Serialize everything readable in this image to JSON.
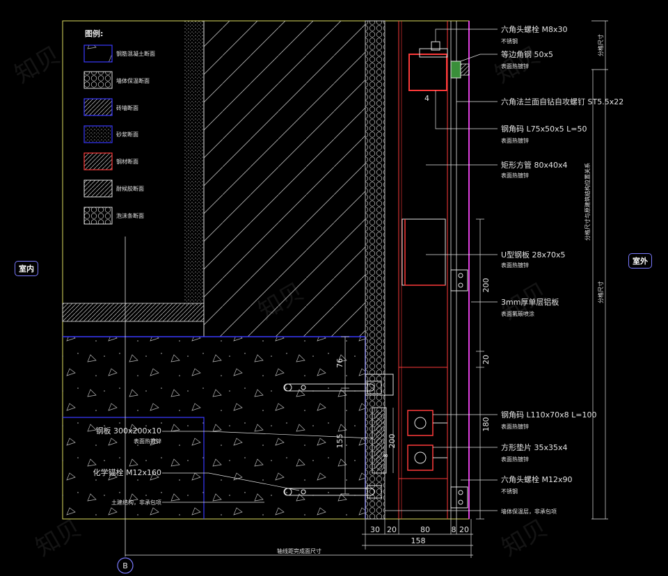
{
  "tags": {
    "indoor": "室内",
    "outdoor": "室外",
    "axis": "B"
  },
  "legend": {
    "title": "图例:",
    "items": [
      {
        "label": "钢筋混凝土断面"
      },
      {
        "label": "墙体保温断面"
      },
      {
        "label": "砖墙断面"
      },
      {
        "label": "砂浆断面"
      },
      {
        "label": "钢材断面"
      },
      {
        "label": "耐候胶断面"
      },
      {
        "label": "泡沫条断面"
      }
    ]
  },
  "callouts_right": [
    {
      "main": "六角头螺栓 M8x30",
      "sub": "不锈钢"
    },
    {
      "main": "等边角钢 50x5",
      "sub": "表面热镀锌"
    },
    {
      "main": "六角法兰面自钻自攻螺钉 ST5.5x22",
      "sub": ""
    },
    {
      "main": "钢角码 L75x50x5 L=50",
      "sub": "表面热镀锌"
    },
    {
      "main": "矩形方管 80x40x4",
      "sub": "表面热镀锌"
    },
    {
      "main": "U型钢板 28x70x5",
      "sub": "表面热镀锌"
    },
    {
      "main": "3mm厚单层铝板",
      "sub": "表面氟碳喷涂"
    },
    {
      "main": "钢角码 L110x70x8 L=100",
      "sub": "表面热镀锌"
    },
    {
      "main": "方形垫片 35x35x4",
      "sub": "表面热镀锌"
    },
    {
      "main": "六角头螺栓 M12x90",
      "sub": "不锈钢"
    },
    {
      "main": "墙体保温层，非承包项",
      "sub": ""
    }
  ],
  "callouts_left": [
    {
      "main": "钢板 300x200x10",
      "sub": "表面热镀锌"
    },
    {
      "main": "化学锚栓 M12x160",
      "sub": ""
    },
    {
      "main": "土建结构，非承包项",
      "sub": ""
    }
  ],
  "vertical_notes": {
    "far_right_top": "分格尺寸",
    "far_right_mid": "分格尺寸与原建筑结构位置关系",
    "far_right_bottom": "分格尺寸"
  },
  "dimensions": {
    "bottom": [
      "30",
      "20",
      "80",
      "8",
      "20"
    ],
    "total": "158",
    "axis_note": "轴线距完成面尺寸",
    "right_vertical": [
      "200",
      "20",
      "180"
    ],
    "left_vertical": [
      "76",
      "155",
      "200"
    ],
    "small": [
      "4",
      "8"
    ]
  },
  "watermark": "知贝",
  "colors": {
    "bg": "#000000",
    "concrete": "#3a3aff",
    "steel": "#ff3a3a",
    "cladding": "#e040e0",
    "frame": "#e0e060",
    "line": "#e6e6e6"
  }
}
